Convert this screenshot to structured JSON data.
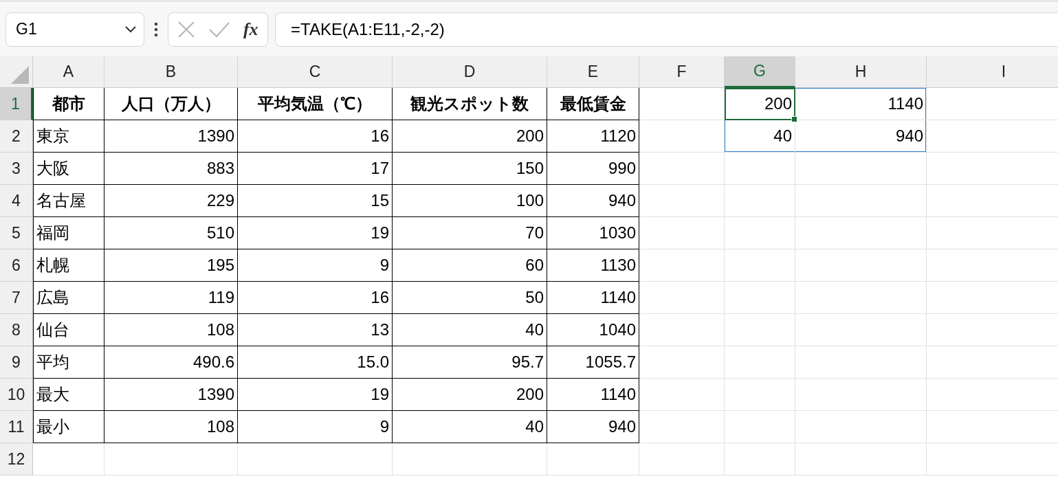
{
  "name_box": {
    "value": "G1"
  },
  "formula_bar": {
    "function_label": "fx",
    "formula": "=TAKE(A1:E11,-2,-2)"
  },
  "column_headers": [
    {
      "label": "A",
      "selected": false
    },
    {
      "label": "B",
      "selected": false
    },
    {
      "label": "C",
      "selected": false
    },
    {
      "label": "D",
      "selected": false
    },
    {
      "label": "E",
      "selected": false
    },
    {
      "label": "F",
      "selected": false
    },
    {
      "label": "G",
      "selected": true
    },
    {
      "label": "H",
      "selected": false
    },
    {
      "label": "I",
      "selected": false
    }
  ],
  "row_headers": [
    {
      "label": "1",
      "selected": true
    },
    {
      "label": "2",
      "selected": false
    },
    {
      "label": "3",
      "selected": false
    },
    {
      "label": "4",
      "selected": false
    },
    {
      "label": "5",
      "selected": false
    },
    {
      "label": "6",
      "selected": false
    },
    {
      "label": "7",
      "selected": false
    },
    {
      "label": "8",
      "selected": false
    },
    {
      "label": "9",
      "selected": false
    },
    {
      "label": "10",
      "selected": false
    },
    {
      "label": "11",
      "selected": false
    },
    {
      "label": "12",
      "selected": false
    }
  ],
  "table": {
    "header": [
      "都市",
      "人口（万人）",
      "平均気温（℃）",
      "観光スポット数",
      "最低賃金"
    ],
    "rows": [
      [
        "東京",
        "1390",
        "16",
        "200",
        "1120"
      ],
      [
        "大阪",
        "883",
        "17",
        "150",
        "990"
      ],
      [
        "名古屋",
        "229",
        "15",
        "100",
        "940"
      ],
      [
        "福岡",
        "510",
        "19",
        "70",
        "1030"
      ],
      [
        "札幌",
        "195",
        "9",
        "60",
        "1130"
      ],
      [
        "広島",
        "119",
        "16",
        "50",
        "1140"
      ],
      [
        "仙台",
        "108",
        "13",
        "40",
        "1040"
      ],
      [
        "平均",
        "490.6",
        "15.0",
        "95.7",
        "1055.7"
      ],
      [
        "最大",
        "1390",
        "19",
        "200",
        "1140"
      ],
      [
        "最小",
        "108",
        "9",
        "40",
        "940"
      ]
    ]
  },
  "spill": {
    "rows": [
      {
        "cells": [
          {
            "text": "200",
            "selected": true
          },
          {
            "text": "1140",
            "selected": false
          }
        ]
      },
      {
        "cells": [
          {
            "text": "40",
            "selected": false
          },
          {
            "text": "940",
            "selected": false
          }
        ]
      }
    ]
  }
}
